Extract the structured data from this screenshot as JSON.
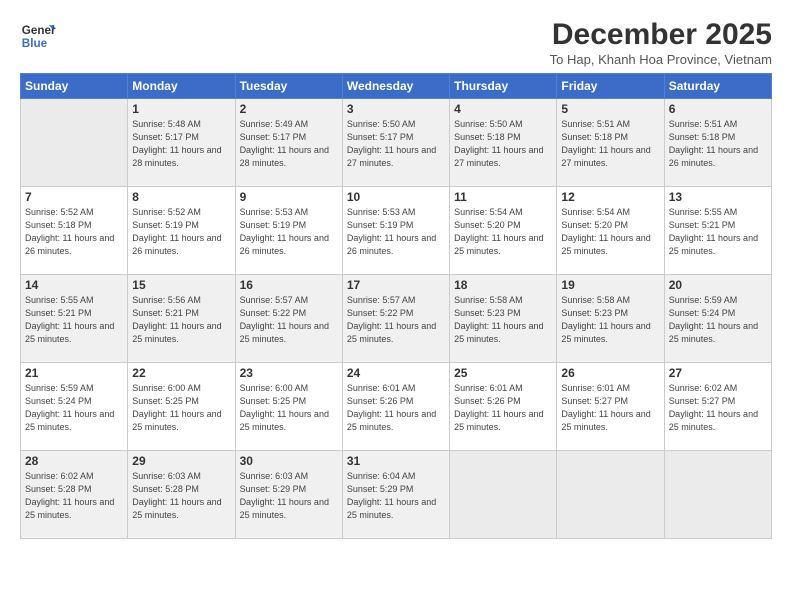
{
  "header": {
    "logo_line1": "General",
    "logo_line2": "Blue",
    "month": "December 2025",
    "location": "To Hap, Khanh Hoa Province, Vietnam"
  },
  "weekdays": [
    "Sunday",
    "Monday",
    "Tuesday",
    "Wednesday",
    "Thursday",
    "Friday",
    "Saturday"
  ],
  "weeks": [
    [
      {
        "day": "",
        "sunrise": "",
        "sunset": "",
        "daylight": ""
      },
      {
        "day": "1",
        "sunrise": "Sunrise: 5:48 AM",
        "sunset": "Sunset: 5:17 PM",
        "daylight": "Daylight: 11 hours and 28 minutes."
      },
      {
        "day": "2",
        "sunrise": "Sunrise: 5:49 AM",
        "sunset": "Sunset: 5:17 PM",
        "daylight": "Daylight: 11 hours and 28 minutes."
      },
      {
        "day": "3",
        "sunrise": "Sunrise: 5:50 AM",
        "sunset": "Sunset: 5:17 PM",
        "daylight": "Daylight: 11 hours and 27 minutes."
      },
      {
        "day": "4",
        "sunrise": "Sunrise: 5:50 AM",
        "sunset": "Sunset: 5:18 PM",
        "daylight": "Daylight: 11 hours and 27 minutes."
      },
      {
        "day": "5",
        "sunrise": "Sunrise: 5:51 AM",
        "sunset": "Sunset: 5:18 PM",
        "daylight": "Daylight: 11 hours and 27 minutes."
      },
      {
        "day": "6",
        "sunrise": "Sunrise: 5:51 AM",
        "sunset": "Sunset: 5:18 PM",
        "daylight": "Daylight: 11 hours and 26 minutes."
      }
    ],
    [
      {
        "day": "7",
        "sunrise": "Sunrise: 5:52 AM",
        "sunset": "Sunset: 5:18 PM",
        "daylight": "Daylight: 11 hours and 26 minutes."
      },
      {
        "day": "8",
        "sunrise": "Sunrise: 5:52 AM",
        "sunset": "Sunset: 5:19 PM",
        "daylight": "Daylight: 11 hours and 26 minutes."
      },
      {
        "day": "9",
        "sunrise": "Sunrise: 5:53 AM",
        "sunset": "Sunset: 5:19 PM",
        "daylight": "Daylight: 11 hours and 26 minutes."
      },
      {
        "day": "10",
        "sunrise": "Sunrise: 5:53 AM",
        "sunset": "Sunset: 5:19 PM",
        "daylight": "Daylight: 11 hours and 26 minutes."
      },
      {
        "day": "11",
        "sunrise": "Sunrise: 5:54 AM",
        "sunset": "Sunset: 5:20 PM",
        "daylight": "Daylight: 11 hours and 25 minutes."
      },
      {
        "day": "12",
        "sunrise": "Sunrise: 5:54 AM",
        "sunset": "Sunset: 5:20 PM",
        "daylight": "Daylight: 11 hours and 25 minutes."
      },
      {
        "day": "13",
        "sunrise": "Sunrise: 5:55 AM",
        "sunset": "Sunset: 5:21 PM",
        "daylight": "Daylight: 11 hours and 25 minutes."
      }
    ],
    [
      {
        "day": "14",
        "sunrise": "Sunrise: 5:55 AM",
        "sunset": "Sunset: 5:21 PM",
        "daylight": "Daylight: 11 hours and 25 minutes."
      },
      {
        "day": "15",
        "sunrise": "Sunrise: 5:56 AM",
        "sunset": "Sunset: 5:21 PM",
        "daylight": "Daylight: 11 hours and 25 minutes."
      },
      {
        "day": "16",
        "sunrise": "Sunrise: 5:57 AM",
        "sunset": "Sunset: 5:22 PM",
        "daylight": "Daylight: 11 hours and 25 minutes."
      },
      {
        "day": "17",
        "sunrise": "Sunrise: 5:57 AM",
        "sunset": "Sunset: 5:22 PM",
        "daylight": "Daylight: 11 hours and 25 minutes."
      },
      {
        "day": "18",
        "sunrise": "Sunrise: 5:58 AM",
        "sunset": "Sunset: 5:23 PM",
        "daylight": "Daylight: 11 hours and 25 minutes."
      },
      {
        "day": "19",
        "sunrise": "Sunrise: 5:58 AM",
        "sunset": "Sunset: 5:23 PM",
        "daylight": "Daylight: 11 hours and 25 minutes."
      },
      {
        "day": "20",
        "sunrise": "Sunrise: 5:59 AM",
        "sunset": "Sunset: 5:24 PM",
        "daylight": "Daylight: 11 hours and 25 minutes."
      }
    ],
    [
      {
        "day": "21",
        "sunrise": "Sunrise: 5:59 AM",
        "sunset": "Sunset: 5:24 PM",
        "daylight": "Daylight: 11 hours and 25 minutes."
      },
      {
        "day": "22",
        "sunrise": "Sunrise: 6:00 AM",
        "sunset": "Sunset: 5:25 PM",
        "daylight": "Daylight: 11 hours and 25 minutes."
      },
      {
        "day": "23",
        "sunrise": "Sunrise: 6:00 AM",
        "sunset": "Sunset: 5:25 PM",
        "daylight": "Daylight: 11 hours and 25 minutes."
      },
      {
        "day": "24",
        "sunrise": "Sunrise: 6:01 AM",
        "sunset": "Sunset: 5:26 PM",
        "daylight": "Daylight: 11 hours and 25 minutes."
      },
      {
        "day": "25",
        "sunrise": "Sunrise: 6:01 AM",
        "sunset": "Sunset: 5:26 PM",
        "daylight": "Daylight: 11 hours and 25 minutes."
      },
      {
        "day": "26",
        "sunrise": "Sunrise: 6:01 AM",
        "sunset": "Sunset: 5:27 PM",
        "daylight": "Daylight: 11 hours and 25 minutes."
      },
      {
        "day": "27",
        "sunrise": "Sunrise: 6:02 AM",
        "sunset": "Sunset: 5:27 PM",
        "daylight": "Daylight: 11 hours and 25 minutes."
      }
    ],
    [
      {
        "day": "28",
        "sunrise": "Sunrise: 6:02 AM",
        "sunset": "Sunset: 5:28 PM",
        "daylight": "Daylight: 11 hours and 25 minutes."
      },
      {
        "day": "29",
        "sunrise": "Sunrise: 6:03 AM",
        "sunset": "Sunset: 5:28 PM",
        "daylight": "Daylight: 11 hours and 25 minutes."
      },
      {
        "day": "30",
        "sunrise": "Sunrise: 6:03 AM",
        "sunset": "Sunset: 5:29 PM",
        "daylight": "Daylight: 11 hours and 25 minutes."
      },
      {
        "day": "31",
        "sunrise": "Sunrise: 6:04 AM",
        "sunset": "Sunset: 5:29 PM",
        "daylight": "Daylight: 11 hours and 25 minutes."
      },
      {
        "day": "",
        "sunrise": "",
        "sunset": "",
        "daylight": ""
      },
      {
        "day": "",
        "sunrise": "",
        "sunset": "",
        "daylight": ""
      },
      {
        "day": "",
        "sunrise": "",
        "sunset": "",
        "daylight": ""
      }
    ]
  ]
}
